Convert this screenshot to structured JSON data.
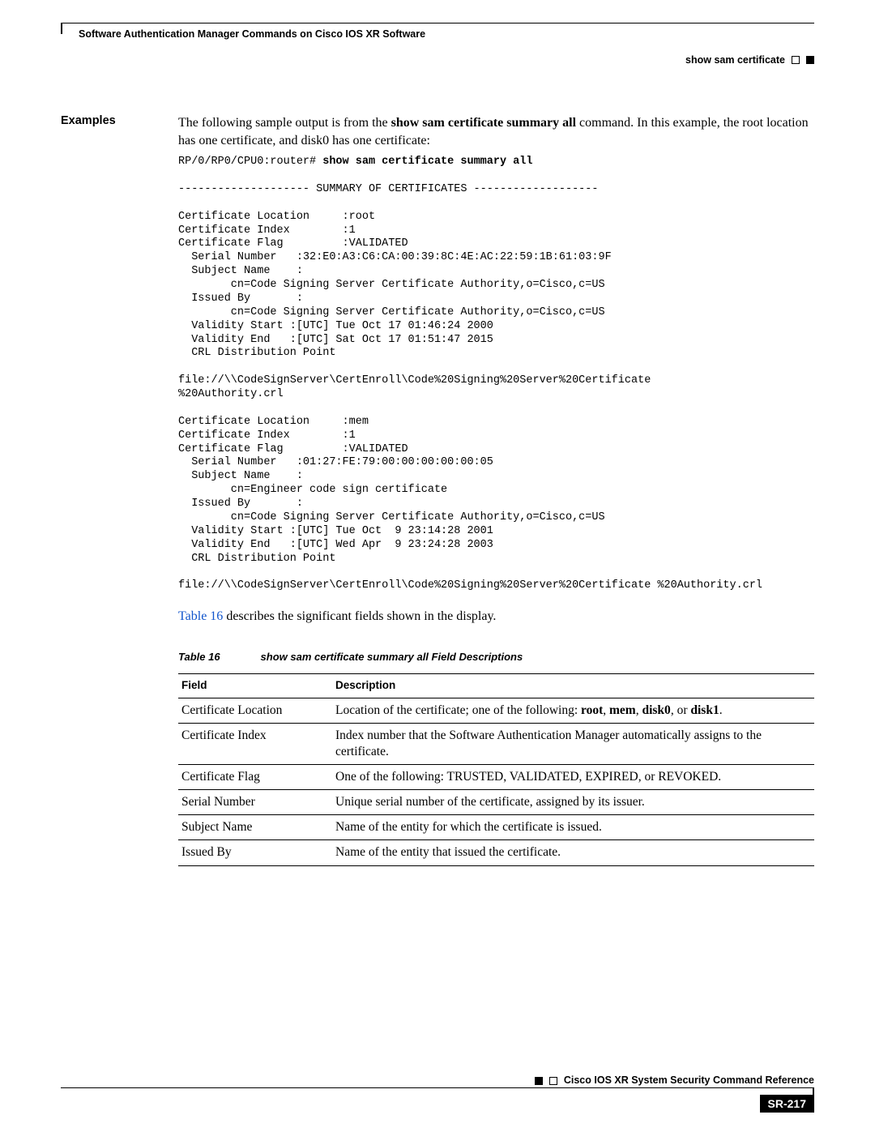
{
  "header": {
    "chapter": "Software Authentication Manager Commands on Cisco IOS XR Software",
    "breadcrumb": "show sam certificate"
  },
  "section_label": "Examples",
  "intro": {
    "pre": "The following sample output is from the ",
    "cmd": "show sam certificate summary all",
    "post": " command. In this example, the root location has one certificate, and disk0 has one certificate:"
  },
  "cli": {
    "prompt": "RP/0/RP0/CPU0:router# ",
    "command": "show sam certificate summary all",
    "output": "-------------------- SUMMARY OF CERTIFICATES -------------------\n\nCertificate Location     :root\nCertificate Index        :1\nCertificate Flag         :VALIDATED\n  Serial Number   :32:E0:A3:C6:CA:00:39:8C:4E:AC:22:59:1B:61:03:9F\n  Subject Name    :\n        cn=Code Signing Server Certificate Authority,o=Cisco,c=US\n  Issued By       :\n        cn=Code Signing Server Certificate Authority,o=Cisco,c=US\n  Validity Start :[UTC] Tue Oct 17 01:46:24 2000\n  Validity End   :[UTC] Sat Oct 17 01:51:47 2015\n  CRL Distribution Point\n\nfile://\\\\CodeSignServer\\CertEnroll\\Code%20Signing%20Server%20Certificate\n%20Authority.crl\n\nCertificate Location     :mem\nCertificate Index        :1\nCertificate Flag         :VALIDATED\n  Serial Number   :01:27:FE:79:00:00:00:00:00:05\n  Subject Name    :\n        cn=Engineer code sign certificate\n  Issued By       :\n        cn=Code Signing Server Certificate Authority,o=Cisco,c=US\n  Validity Start :[UTC] Tue Oct  9 23:14:28 2001\n  Validity End   :[UTC] Wed Apr  9 23:24:28 2003\n  CRL Distribution Point\n\nfile://\\\\CodeSignServer\\CertEnroll\\Code%20Signing%20Server%20Certificate %20Authority.crl"
  },
  "table_ref": {
    "link": "Table 16",
    "rest": " describes the significant fields shown in the display."
  },
  "table_caption": {
    "num": "Table 16",
    "title": "show sam certificate summary all Field Descriptions"
  },
  "table_headers": {
    "field": "Field",
    "desc": "Description"
  },
  "rows": [
    {
      "field": "Certificate Location",
      "desc_pre": "Location of the certificate; one of the following: ",
      "b1": "root",
      "s1": ", ",
      "b2": "mem",
      "s2": ", ",
      "b3": "disk0",
      "s3": ", or ",
      "b4": "disk1",
      "s4": "."
    },
    {
      "field": "Certificate Index",
      "desc": "Index number that the Software Authentication Manager automatically assigns to the certificate."
    },
    {
      "field": "Certificate Flag",
      "desc": "One of the following: TRUSTED, VALIDATED, EXPIRED, or REVOKED."
    },
    {
      "field": "Serial Number",
      "desc": "Unique serial number of the certificate, assigned by its issuer."
    },
    {
      "field": "Subject Name",
      "desc": "Name of the entity for which the certificate is issued."
    },
    {
      "field": "Issued By",
      "desc": "Name of the entity that issued the certificate."
    }
  ],
  "footer": {
    "title": "Cisco IOS XR System Security Command Reference",
    "page": "SR-217"
  }
}
